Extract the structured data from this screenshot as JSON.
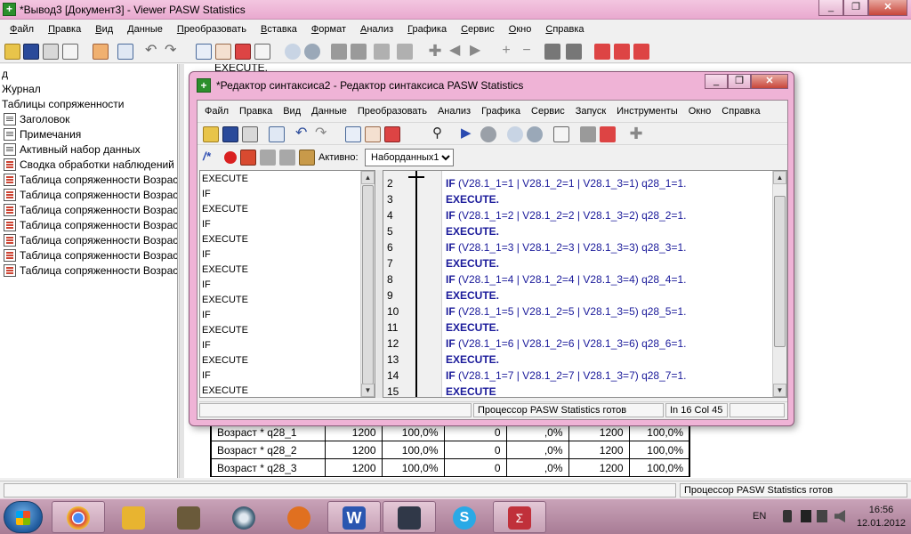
{
  "viewer": {
    "title": "*Вывод3 [Документ3] - Viewer PASW Statistics",
    "menu": [
      "Файл",
      "Правка",
      "Вид",
      "Данные",
      "Преобразовать",
      "Вставка",
      "Формат",
      "Анализ",
      "Графика",
      "Сервис",
      "Окно",
      "Справка"
    ],
    "content_partial": "EXECUTE.",
    "outline": [
      {
        "label": "д",
        "icon": "none"
      },
      {
        "label": "Журнал",
        "icon": "none"
      },
      {
        "label": "Таблицы сопряженности",
        "icon": "none"
      },
      {
        "label": "Заголовок",
        "icon": "doc"
      },
      {
        "label": "Примечания",
        "icon": "doc"
      },
      {
        "label": "Активный набор данных",
        "icon": "doc"
      },
      {
        "label": "Сводка обработки наблюдений",
        "icon": "tbl"
      },
      {
        "label": "Таблица сопряженности Возраст",
        "icon": "tbl"
      },
      {
        "label": "Таблица сопряженности Возраст",
        "icon": "tbl"
      },
      {
        "label": "Таблица сопряженности Возраст",
        "icon": "tbl"
      },
      {
        "label": "Таблица сопряженности Возраст",
        "icon": "tbl"
      },
      {
        "label": "Таблица сопряженности Возраст",
        "icon": "tbl"
      },
      {
        "label": "Таблица сопряженности Возраст",
        "icon": "tbl"
      },
      {
        "label": "Таблица сопряженности Возраст",
        "icon": "tbl"
      }
    ],
    "table_rows": [
      [
        "Возраст * q28_1",
        "1200",
        "100,0%",
        "0",
        ",0%",
        "1200",
        "100,0%"
      ],
      [
        "Возраст * q28_2",
        "1200",
        "100,0%",
        "0",
        ",0%",
        "1200",
        "100,0%"
      ],
      [
        "Возраст * q28_3",
        "1200",
        "100,0%",
        "0",
        ",0%",
        "1200",
        "100,0%"
      ]
    ],
    "status_processor": "Процессор PASW Statistics  готов"
  },
  "syntax": {
    "title": "*Редактор синтаксиса2 - Редактор синтаксиса PASW Statistics",
    "menu": [
      "Файл",
      "Правка",
      "Вид",
      "Данные",
      "Преобразовать",
      "Анализ",
      "Графика",
      "Сервис",
      "Запуск",
      "Инструменты",
      "Окно",
      "Справка"
    ],
    "active_label": "Активно:",
    "active_value": "Наборданных1",
    "nav_items": [
      "EXECUTE",
      "IF",
      "EXECUTE",
      "IF",
      "EXECUTE",
      "IF",
      "EXECUTE",
      "IF",
      "EXECUTE",
      "IF",
      "EXECUTE",
      "IF",
      "EXECUTE",
      "IF",
      "EXECUTE"
    ],
    "lines": [
      {
        "n": "2",
        "kw": "IF",
        "body": "  (V28.1_1=1 | V28.1_2=1 | V28.1_3=1) q28_1=1."
      },
      {
        "n": "3",
        "kw": "EXECUTE.",
        "body": ""
      },
      {
        "n": "4",
        "kw": "IF",
        "body": "  (V28.1_1=2 | V28.1_2=2 | V28.1_3=2) q28_2=1."
      },
      {
        "n": "5",
        "kw": "EXECUTE.",
        "body": ""
      },
      {
        "n": "6",
        "kw": "IF",
        "body": "  (V28.1_1=3 | V28.1_2=3 | V28.1_3=3) q28_3=1."
      },
      {
        "n": "7",
        "kw": "EXECUTE.",
        "body": ""
      },
      {
        "n": "8",
        "kw": "IF",
        "body": "  (V28.1_1=4 | V28.1_2=4 | V28.1_3=4) q28_4=1."
      },
      {
        "n": "9",
        "kw": "EXECUTE.",
        "body": ""
      },
      {
        "n": "10",
        "kw": "IF",
        "body": "  (V28.1_1=5 | V28.1_2=5 | V28.1_3=5) q28_5=1."
      },
      {
        "n": "11",
        "kw": "EXECUTE.",
        "body": ""
      },
      {
        "n": "12",
        "kw": "IF",
        "body": "  (V28.1_1=6 | V28.1_2=6 | V28.1_3=6) q28_6=1."
      },
      {
        "n": "13",
        "kw": "EXECUTE.",
        "body": ""
      },
      {
        "n": "14",
        "kw": "IF",
        "body": "  (V28.1_1=7 | V28.1_2=7 | V28.1_3=7) q28_7=1."
      },
      {
        "n": "15",
        "kw": "EXECUTE",
        "body": ""
      }
    ],
    "status_processor": "Процессор PASW Statistics  готов",
    "status_position": "In 16 Col 45"
  },
  "taskbar": {
    "lang": "EN",
    "time": "16:56",
    "date": "12.01.2012",
    "colors": {
      "chrome": "#d9413a",
      "app2": "#e8b430",
      "app3": "#6a5a3a",
      "app4": "#4a6a80",
      "app5": "#e07020",
      "word": "#2a56b0",
      "app7": "#303848",
      "skype": "#2aa9e6",
      "spss": "#c0303a"
    }
  }
}
